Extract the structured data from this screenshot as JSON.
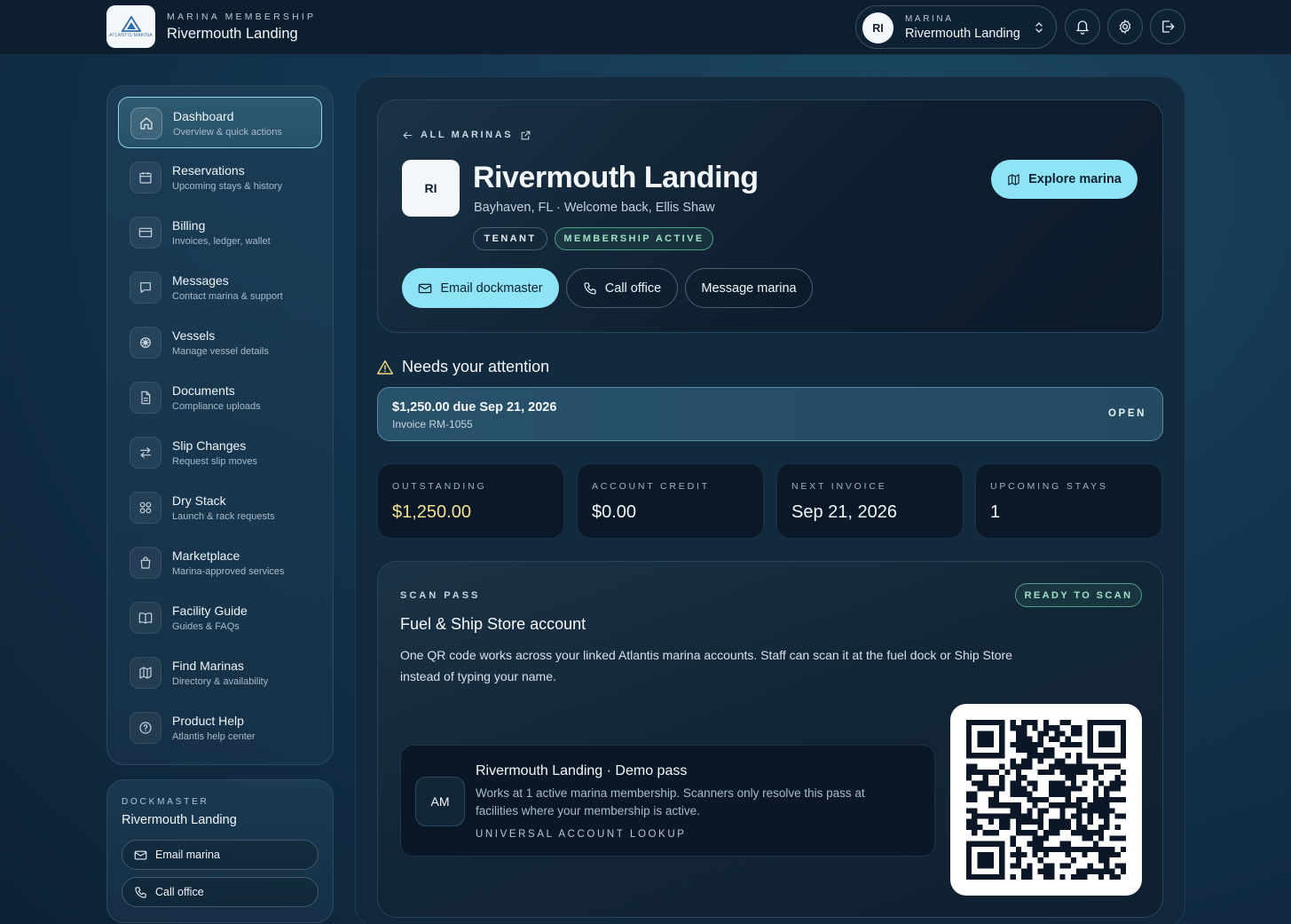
{
  "header": {
    "logo_text": "ATLANTIS MARINA",
    "eyebrow": "MARINA MEMBERSHIP",
    "title": "Rivermouth Landing",
    "switcher": {
      "initials": "RI",
      "label": "MARINA",
      "value": "Rivermouth Landing"
    },
    "icons": [
      "bell-icon",
      "gear-icon",
      "logout-icon"
    ]
  },
  "sidebar": {
    "items": [
      {
        "label": "Dashboard",
        "sub": "Overview & quick actions",
        "icon": "home-icon",
        "active": true
      },
      {
        "label": "Reservations",
        "sub": "Upcoming stays & history",
        "icon": "calendar-icon"
      },
      {
        "label": "Billing",
        "sub": "Invoices, ledger, wallet",
        "icon": "credit-card-icon"
      },
      {
        "label": "Messages",
        "sub": "Contact marina & support",
        "icon": "chat-icon"
      },
      {
        "label": "Vessels",
        "sub": "Manage vessel details",
        "icon": "ship-wheel-icon"
      },
      {
        "label": "Documents",
        "sub": "Compliance uploads",
        "icon": "document-icon"
      },
      {
        "label": "Slip Changes",
        "sub": "Request slip moves",
        "icon": "swap-arrows-icon"
      },
      {
        "label": "Dry Stack",
        "sub": "Launch & rack requests",
        "icon": "grid-icon"
      },
      {
        "label": "Marketplace",
        "sub": "Marina-approved services",
        "icon": "shopping-bag-icon"
      },
      {
        "label": "Facility Guide",
        "sub": "Guides & FAQs",
        "icon": "book-icon"
      },
      {
        "label": "Find Marinas",
        "sub": "Directory & availability",
        "icon": "map-icon"
      },
      {
        "label": "Product Help",
        "sub": "Atlantis help center",
        "icon": "help-circle-icon"
      }
    ]
  },
  "dockmaster": {
    "eyebrow": "DOCKMASTER",
    "name": "Rivermouth Landing",
    "email_label": "Email marina",
    "call_label": "Call office"
  },
  "hero": {
    "back_label": "ALL MARINAS",
    "initials": "RI",
    "title": "Rivermouth Landing",
    "subtitle": "Bayhaven, FL · Welcome back, Ellis Shaw",
    "tags": [
      "TENANT",
      "MEMBERSHIP ACTIVE"
    ],
    "explore_label": "Explore marina",
    "actions": {
      "email": "Email dockmaster",
      "call": "Call office",
      "message": "Message marina"
    }
  },
  "attention": {
    "heading": "Needs your attention",
    "item": {
      "title": "$1,250.00 due Sep 21, 2026",
      "sub": "Invoice RM-1055",
      "status": "OPEN"
    }
  },
  "stats": [
    {
      "label": "OUTSTANDING",
      "value": "$1,250.00",
      "color": "#f6e08a"
    },
    {
      "label": "ACCOUNT CREDIT",
      "value": "$0.00",
      "color": "#f2f6f9"
    },
    {
      "label": "NEXT INVOICE",
      "value": "Sep 21, 2026",
      "color": "#f2f6f9"
    },
    {
      "label": "UPCOMING STAYS",
      "value": "1",
      "color": "#f2f6f9"
    }
  ],
  "scan_pass": {
    "eyebrow": "SCAN PASS",
    "status": "READY TO SCAN",
    "title": "Fuel & Ship Store account",
    "description": "One QR code works across your linked Atlantis marina accounts. Staff can scan it at the fuel dock or Ship Store instead of typing your name.",
    "pass": {
      "initials": "AM",
      "title": "Rivermouth Landing · Demo pass",
      "description": "Works at 1 active marina membership. Scanners only resolve this pass at facilities where your membership is active.",
      "footer": "UNIVERSAL ACCOUNT LOOKUP"
    }
  },
  "colors": {
    "accent": "#8ee3f4",
    "success": "#9fe0c6",
    "warning": "#f6e08a",
    "bg": "#0f2a40"
  }
}
